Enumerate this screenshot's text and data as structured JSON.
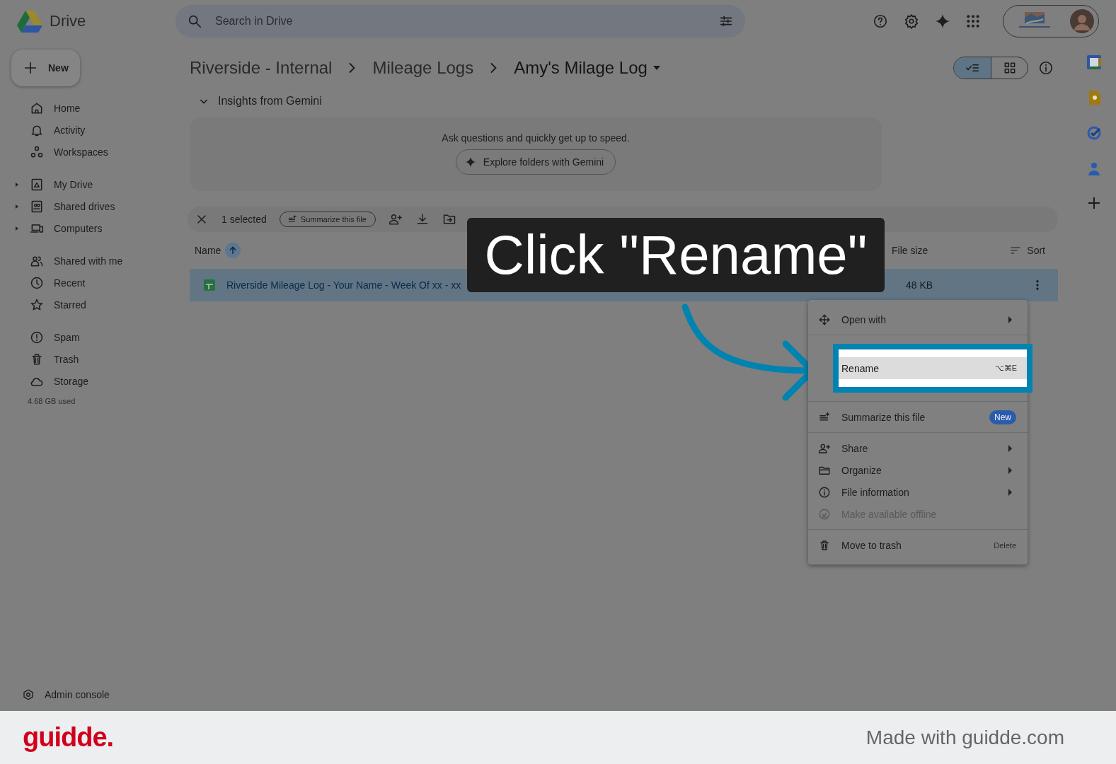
{
  "app": {
    "name": "Drive"
  },
  "search": {
    "placeholder": "Search in Drive"
  },
  "new_button": "New",
  "sidebar": {
    "groups": [
      [
        {
          "label": "Home",
          "kind": "home",
          "expandable": false
        },
        {
          "label": "Activity",
          "kind": "bell",
          "expandable": false
        },
        {
          "label": "Workspaces",
          "kind": "workspaces",
          "expandable": false
        }
      ],
      [
        {
          "label": "My Drive",
          "kind": "mydrive",
          "expandable": true
        },
        {
          "label": "Shared drives",
          "kind": "shareddrives",
          "expandable": true
        },
        {
          "label": "Computers",
          "kind": "computer",
          "expandable": true
        }
      ],
      [
        {
          "label": "Shared with me",
          "kind": "people",
          "expandable": false
        },
        {
          "label": "Recent",
          "kind": "clock",
          "expandable": false
        },
        {
          "label": "Starred",
          "kind": "star",
          "expandable": false
        }
      ],
      [
        {
          "label": "Spam",
          "kind": "spam",
          "expandable": false
        },
        {
          "label": "Trash",
          "kind": "trash",
          "expandable": false
        },
        {
          "label": "Storage",
          "kind": "cloud",
          "expandable": false
        }
      ]
    ],
    "storage_used": "4.68 GB used",
    "admin": "Admin console"
  },
  "breadcrumbs": [
    "Riverside - Internal",
    "Mileage Logs",
    "Amy's Milage Log"
  ],
  "view_toggle": [
    {
      "kind": "list",
      "selected": true
    },
    {
      "kind": "grid",
      "selected": false
    }
  ],
  "gemini": {
    "title": "Insights from Gemini",
    "expanded": true,
    "prompt": "Ask questions and quickly get up to speed.",
    "button": "Explore folders with Gemini"
  },
  "selection_bar": {
    "count": "1 selected",
    "summarize": "Summarize this file"
  },
  "columns": [
    {
      "label": "Name",
      "sorted": true
    },
    {
      "label": "File size",
      "sorted": false
    }
  ],
  "sort": "Sort",
  "rows": [
    {
      "name": "Riverside Mileage Log - Your Name - Week Of xx - xx",
      "size": "48 KB",
      "selected": true
    }
  ],
  "menu": [
    [
      {
        "label": "Open with",
        "kind": "move",
        "submenu": true,
        "disabled": false,
        "selected": false
      }
    ],
    [
      {
        "label": "Rename",
        "shortcut": "⌥⌘E",
        "submenu": false,
        "disabled": false,
        "selected": true
      }
    ],
    [
      {
        "label": "Summarize this file",
        "kind": "summarize",
        "badge": "New",
        "submenu": false,
        "disabled": false,
        "selected": false
      }
    ],
    [
      {
        "label": "Share",
        "kind": "personadd",
        "submenu": true,
        "disabled": false,
        "selected": false
      },
      {
        "label": "Organize",
        "kind": "folder",
        "submenu": true,
        "disabled": false,
        "selected": false
      },
      {
        "label": "File information",
        "kind": "info",
        "submenu": true,
        "disabled": false,
        "selected": false
      },
      {
        "label": "Make available offline",
        "kind": "offline",
        "submenu": false,
        "disabled": true,
        "selected": false
      }
    ],
    [
      {
        "label": "Move to trash",
        "kind": "trash",
        "shortcut": "Delete",
        "submenu": false,
        "disabled": false,
        "selected": false
      }
    ]
  ],
  "caption": "Click \"Rename\"",
  "footer": {
    "brand": "guidde.",
    "credit": "Made with guidde.com"
  }
}
